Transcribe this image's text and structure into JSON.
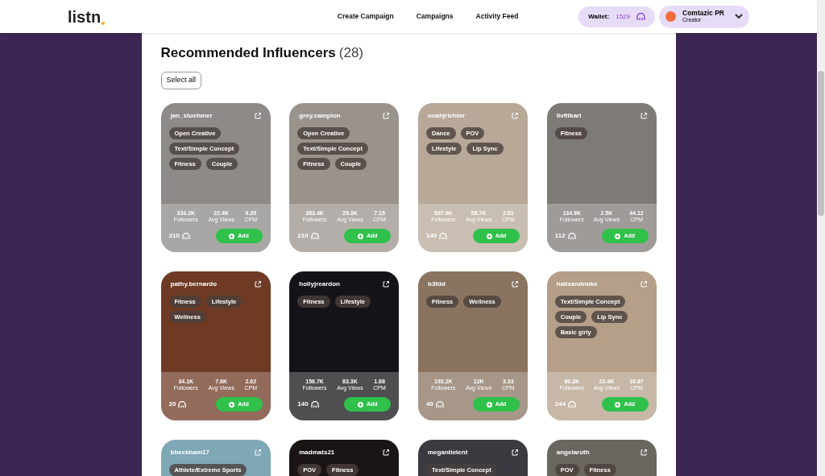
{
  "header": {
    "logo": "listn",
    "nav": [
      "Create Campaign",
      "Campaigns",
      "Activity Feed"
    ],
    "wallet": {
      "label": "Wallet:",
      "amount": "1529"
    },
    "profile": {
      "name": "Comtazic PR",
      "role": "Creator"
    }
  },
  "section": {
    "title": "Recommended Influencers",
    "count": "(28)",
    "select_all": "Select all"
  },
  "cards": [
    {
      "name": "jan_stuehmer",
      "tags": [
        "Open Creative",
        "Text/Simple Concept",
        "Fitness",
        "Couple"
      ],
      "stats": [
        {
          "value": "334.2K",
          "label": "Followers"
        },
        {
          "value": "22.4K",
          "label": "Avg Views"
        },
        {
          "value": "9.35",
          "label": "CPM"
        }
      ],
      "points": "210",
      "add": "Add"
    },
    {
      "name": "grey.campion",
      "tags": [
        "Open Creative",
        "Text/Simple Concept",
        "Fitness",
        "Couple"
      ],
      "stats": [
        {
          "value": "363.4K",
          "label": "Followers"
        },
        {
          "value": "29.3K",
          "label": "Avg Views"
        },
        {
          "value": "7.15",
          "label": "CPM"
        }
      ],
      "points": "210",
      "add": "Add"
    },
    {
      "name": "noahjrichter",
      "tags": [
        "Dance",
        "POV",
        "Lifestyle",
        "Lip Sync"
      ],
      "stats": [
        {
          "value": "537.9K",
          "label": "Followers"
        },
        {
          "value": "55.7K",
          "label": "Avg Views"
        },
        {
          "value": "2.51",
          "label": "CPM"
        }
      ],
      "points": "140",
      "add": "Add"
    },
    {
      "name": "livfitkarl",
      "tags": [
        "Fitness"
      ],
      "stats": [
        {
          "value": "134.9K",
          "label": "Followers"
        },
        {
          "value": "2.5K",
          "label": "Avg Views"
        },
        {
          "value": "44.12",
          "label": "CPM"
        }
      ],
      "points": "112",
      "add": "Add"
    },
    {
      "name": "pathy.bernardo",
      "tags": [
        "Fitness",
        "Lifestyle",
        "Wellness"
      ],
      "stats": [
        {
          "value": "34.1K",
          "label": "Followers"
        },
        {
          "value": "7.6K",
          "label": "Avg Views"
        },
        {
          "value": "2.62",
          "label": "CPM"
        }
      ],
      "points": "20",
      "add": "Add"
    },
    {
      "name": "hollyjreardon",
      "tags": [
        "Fitness",
        "Lifestyle"
      ],
      "stats": [
        {
          "value": "156.7K",
          "label": "Followers"
        },
        {
          "value": "83.3K",
          "label": "Avg Views"
        },
        {
          "value": "1.68",
          "label": "CPM"
        }
      ],
      "points": "140",
      "add": "Add"
    },
    {
      "name": "b3fdd",
      "tags": [
        "Fitness",
        "Wellness"
      ],
      "stats": [
        {
          "value": "193.2K",
          "label": "Followers"
        },
        {
          "value": "12K",
          "label": "Avg Views"
        },
        {
          "value": "3.33",
          "label": "CPM"
        }
      ],
      "points": "40",
      "add": "Add"
    },
    {
      "name": "hailsandmike",
      "tags": [
        "Text/Simple Concept",
        "Couple",
        "Lip Sync",
        "Basic girly"
      ],
      "stats": [
        {
          "value": "60.3K",
          "label": "Followers"
        },
        {
          "value": "22.4K",
          "label": "Avg Views"
        },
        {
          "value": "10.87",
          "label": "CPM"
        }
      ],
      "points": "244",
      "add": "Add"
    },
    {
      "name": "bbeckham17",
      "tags": [
        "Athlete/Extreme Sports"
      ]
    },
    {
      "name": "madmats21",
      "tags": [
        "POV",
        "Fitness"
      ]
    },
    {
      "name": "megantielent",
      "tags": [
        "Text/Simple Concept"
      ]
    },
    {
      "name": "angelaroth",
      "tags": [
        "POV",
        "Fitness"
      ]
    }
  ]
}
